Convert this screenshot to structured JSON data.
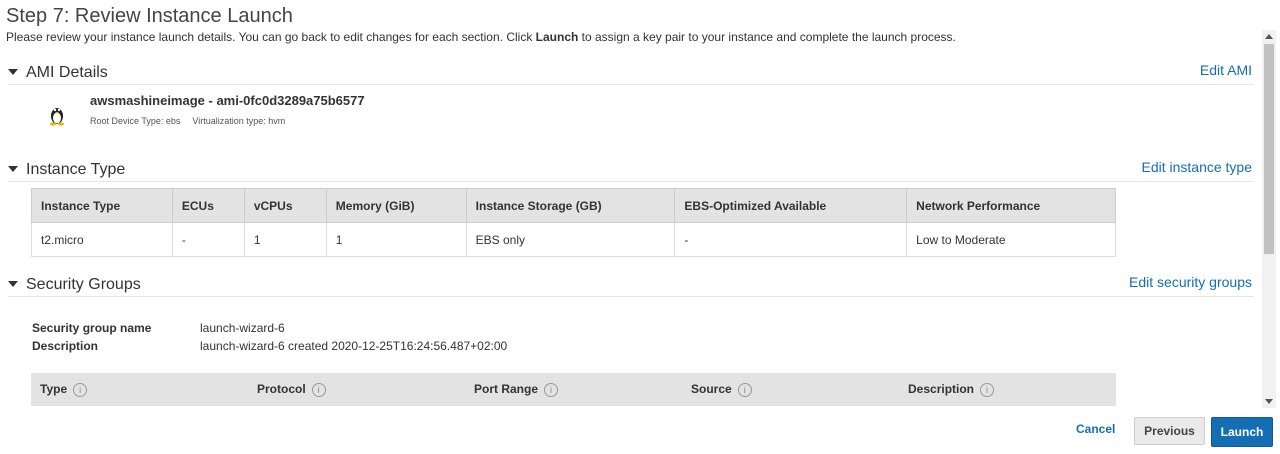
{
  "step": {
    "title": "Step 7: Review Instance Launch",
    "desc_before": "Please review your instance launch details. You can go back to edit changes for each section. Click ",
    "desc_bold": "Launch",
    "desc_after": " to assign a key pair to your instance and complete the launch process."
  },
  "ami": {
    "section_label": "AMI Details",
    "edit_label": "Edit AMI",
    "name": "awsmashineimage - ami-0fc0d3289a75b6577",
    "root_device": "Root Device Type: ebs",
    "virtualization": "Virtualization type: hvm",
    "icon": "linux-penguin-icon"
  },
  "instance_type": {
    "section_label": "Instance Type",
    "edit_label": "Edit instance type",
    "columns": [
      "Instance Type",
      "ECUs",
      "vCPUs",
      "Memory (GiB)",
      "Instance Storage (GB)",
      "EBS-Optimized Available",
      "Network Performance"
    ],
    "row": [
      "t2.micro",
      "-",
      "1",
      "1",
      "EBS only",
      "-",
      "Low to Moderate"
    ]
  },
  "security_groups": {
    "section_label": "Security Groups",
    "edit_label": "Edit security groups",
    "name_label": "Security group name",
    "name_value": "launch-wizard-6",
    "desc_label": "Description",
    "desc_value": "launch-wizard-6 created 2020-12-25T16:24:56.487+02:00",
    "columns": [
      "Type",
      "Protocol",
      "Port Range",
      "Source",
      "Description"
    ]
  },
  "footer": {
    "cancel": "Cancel",
    "previous": "Previous",
    "launch": "Launch"
  },
  "colors": {
    "link": "#146eb4",
    "primary_button": "#146eb4",
    "table_header": "#e3e3e3"
  }
}
